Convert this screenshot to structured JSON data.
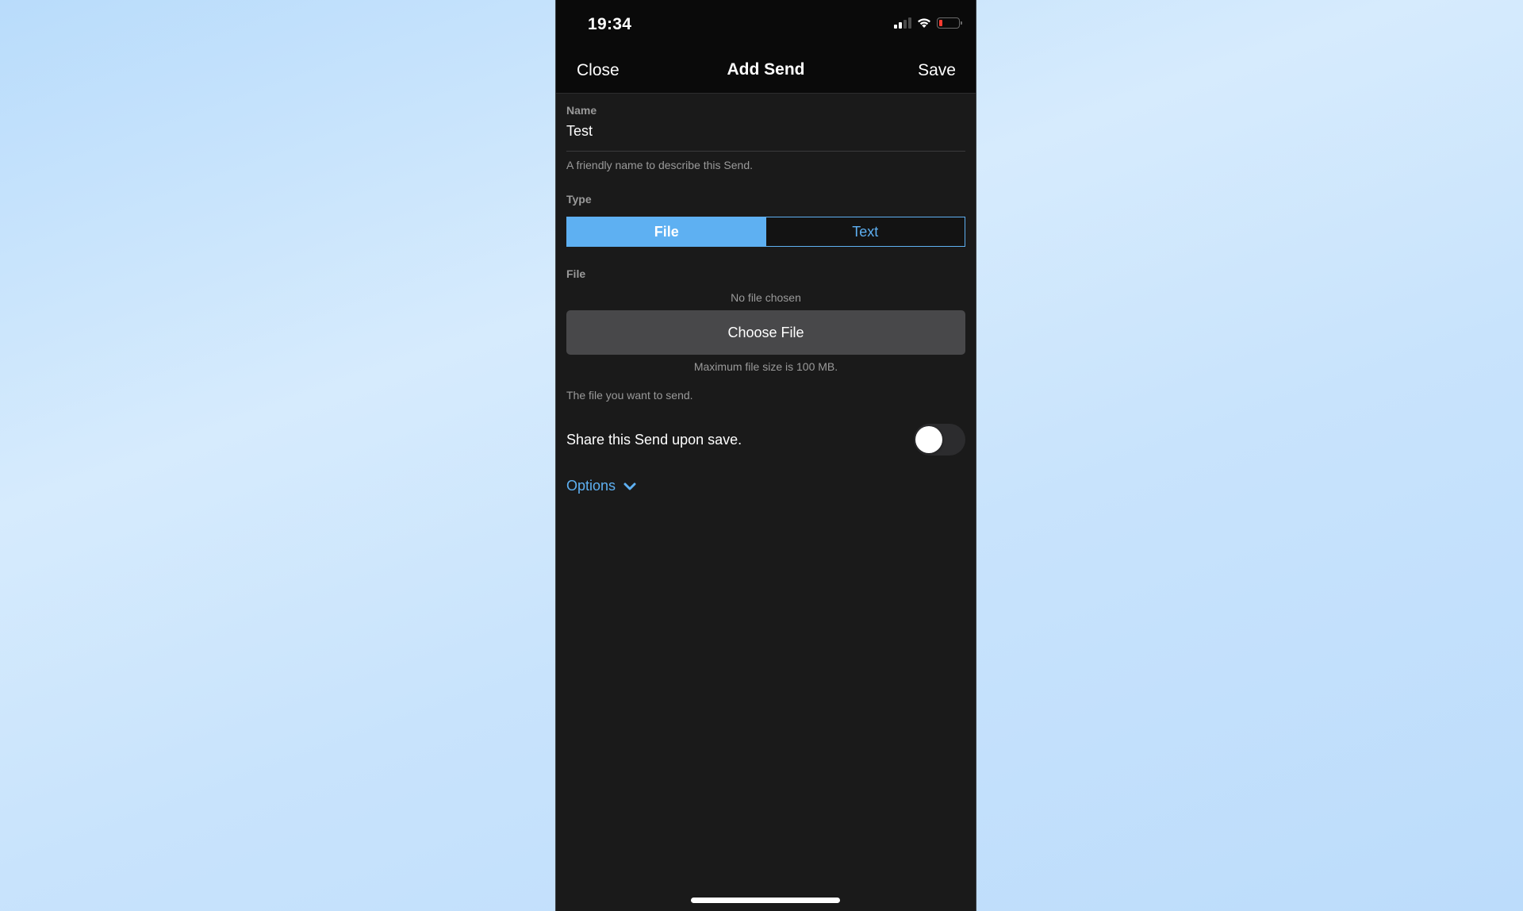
{
  "status_bar": {
    "time": "19:34",
    "signal_bars_filled": 2,
    "signal_bars_total": 4,
    "wifi": "wifi-icon",
    "battery_level": "low",
    "battery_color": "#ff3b30"
  },
  "nav": {
    "close_label": "Close",
    "title": "Add Send",
    "save_label": "Save"
  },
  "form": {
    "name": {
      "label": "Name",
      "value": "Test",
      "helper": "A friendly name to describe this Send."
    },
    "type": {
      "label": "Type",
      "options": [
        "File",
        "Text"
      ],
      "selected": "File"
    },
    "file": {
      "label": "File",
      "status": "No file chosen",
      "button_label": "Choose File",
      "max_size_note": "Maximum file size is 100 MB.",
      "helper": "The file you want to send."
    },
    "share": {
      "label": "Share this Send upon save.",
      "enabled": false
    },
    "options": {
      "label": "Options",
      "icon": "chevron-down-icon"
    }
  },
  "colors": {
    "accent": "#5eb0f2",
    "background": "#1a1a1a",
    "topbar": "#0a0a0a",
    "button": "#48484a"
  }
}
